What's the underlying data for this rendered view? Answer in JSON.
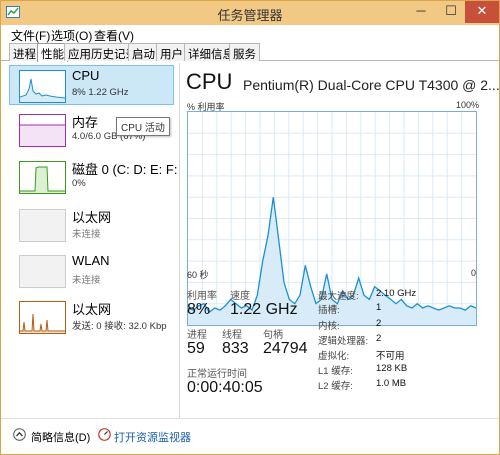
{
  "window": {
    "title": "任务管理器",
    "min_glyph": "─",
    "max_glyph": "☐",
    "close_glyph": "✕"
  },
  "menu": {
    "file": "文件(F)",
    "options": "选项(O)",
    "view": "查看(V)"
  },
  "tabs": [
    "进程",
    "性能",
    "应用历史记录",
    "启动",
    "用户",
    "详细信息",
    "服务"
  ],
  "active_tab": "性能",
  "sidebar": {
    "cpu": {
      "name": "CPU",
      "sub": "8% 1.22 GHz"
    },
    "memory": {
      "name": "内存",
      "sub": "4.0/6.0 GB (67%)"
    },
    "disk": {
      "name": "磁盘 0 (C: D: E: F:",
      "sub": "0%"
    },
    "ethernet": {
      "name": "以太网",
      "sub": "未连接"
    },
    "wlan": {
      "name": "WLAN",
      "sub": "未连接"
    },
    "ethernet2": {
      "name": "以太网",
      "sub": "发送: 0 接收: 32.0 Kbp"
    }
  },
  "tooltip": "CPU 活动",
  "main": {
    "title": "CPU",
    "model": "Pentium(R) Dual-Core CPU T4300 @ 2....",
    "util_label": "% 利用率",
    "max_label": "100%",
    "time_left": "60 秒",
    "time_right": "0"
  },
  "stats": {
    "util_label": "利用率",
    "util": "8%",
    "speed_label": "速度",
    "speed": "1.22 GHz",
    "proc_label": "进程",
    "proc": "59",
    "thread_label": "线程",
    "thread": "833",
    "handle_label": "句柄",
    "handle": "24794",
    "uptime_label": "正常运行时间",
    "uptime": "0:00:40:05"
  },
  "specs": [
    {
      "label": "最大速度:",
      "value": "2.10 GHz"
    },
    {
      "label": "插槽:",
      "value": "1"
    },
    {
      "label": "内核:",
      "value": "2"
    },
    {
      "label": "逻辑处理器:",
      "value": "2"
    },
    {
      "label": "虚拟化:",
      "value": "不可用"
    },
    {
      "label": "L1 缓存:",
      "value": "128 KB"
    },
    {
      "label": "L2 缓存:",
      "value": "1.0 MB"
    }
  ],
  "footer": {
    "brief": "简略信息(D)",
    "resmon": "打开资源监视器"
  },
  "colors": {
    "cpu_line": "#1a8fd8",
    "cpu_fill": "#d7ecf8",
    "memory": "#9f2eb0",
    "disk": "#3c9a1c",
    "ethernet": "#b65c14"
  },
  "chart_data": {
    "type": "area",
    "xlabel": "60 秒",
    "ylabel": "% 利用率",
    "ylim": [
      0,
      100
    ],
    "values": [
      8,
      7,
      9,
      10,
      6,
      8,
      7,
      9,
      12,
      10,
      8,
      9,
      7,
      14,
      30,
      42,
      60,
      40,
      20,
      12,
      10,
      14,
      28,
      18,
      10,
      12,
      24,
      12,
      10,
      16,
      12,
      14,
      22,
      14,
      12,
      18,
      16,
      14,
      12,
      10,
      12,
      9,
      8,
      10,
      8,
      9,
      8,
      7,
      8,
      9,
      8,
      8,
      7,
      9,
      8
    ]
  }
}
